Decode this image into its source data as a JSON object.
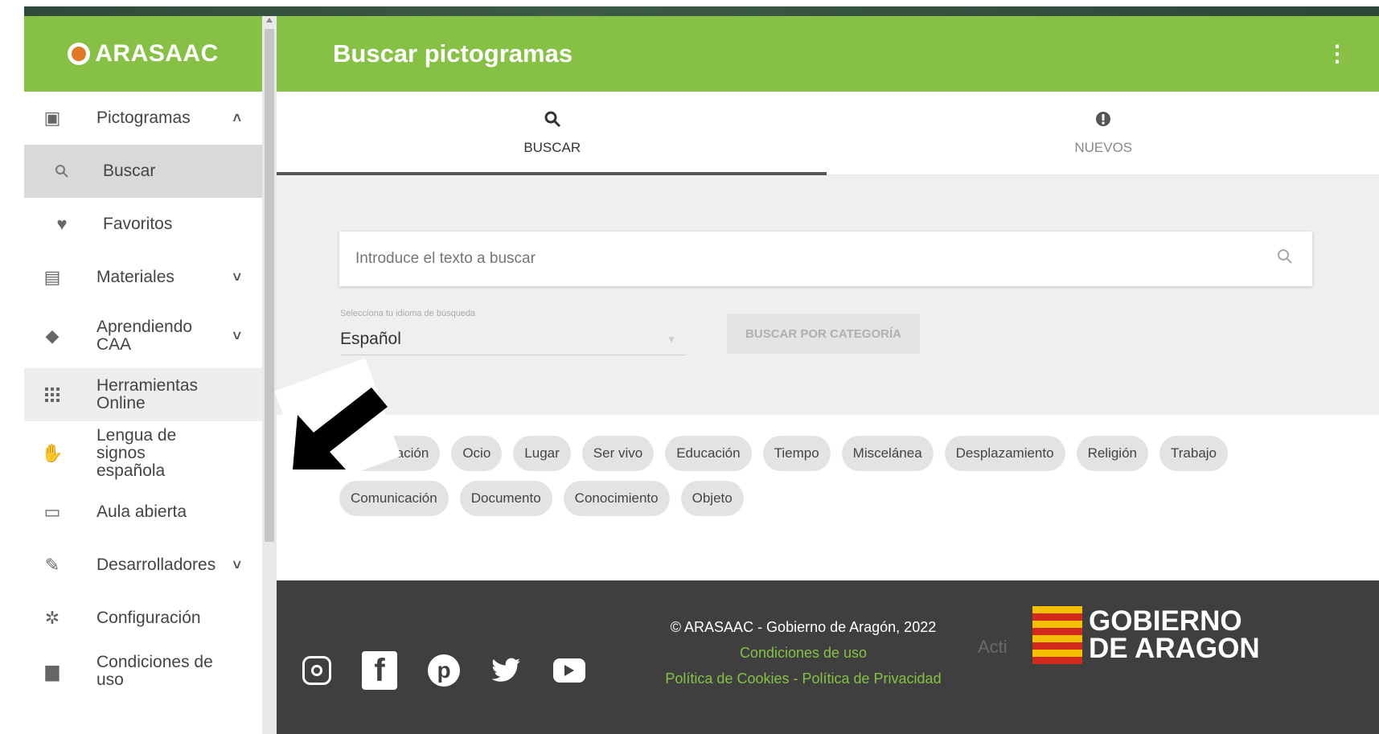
{
  "sidebar": {
    "logo_text": "ARASAAC",
    "items": [
      {
        "label": "Pictogramas",
        "icon": "pictogram-icon",
        "chevron": "˄"
      },
      {
        "label": "Buscar",
        "icon": "search-icon"
      },
      {
        "label": "Favoritos",
        "icon": "heart-icon"
      },
      {
        "label": "Materiales",
        "icon": "materials-icon",
        "chevron": "˅"
      },
      {
        "label": "Aprendiendo CAA",
        "icon": "graduation-cap-icon",
        "chevron": "˅"
      },
      {
        "label": "Herramientas Online",
        "icon": "apps-grid-icon"
      },
      {
        "label": "Lengua de signos española",
        "icon": "sign-language-icon"
      },
      {
        "label": "Aula abierta",
        "icon": "classroom-icon"
      },
      {
        "label": "Desarrolladores",
        "icon": "wrench-icon",
        "chevron": "˅"
      },
      {
        "label": "Configuración",
        "icon": "gear-icon"
      },
      {
        "label": "Condiciones de uso",
        "icon": "briefcase-icon"
      }
    ]
  },
  "header": {
    "title": "Buscar pictogramas",
    "more_icon": "⋮"
  },
  "tabs": [
    {
      "label": "BUSCAR",
      "icon": "search-icon"
    },
    {
      "label": "NUEVOS",
      "icon": "new-badge-icon"
    }
  ],
  "search": {
    "placeholder": "Introduce el texto a buscar",
    "language_label": "Selecciona tu idioma de búsqueda",
    "language_value": "Español",
    "category_button": "BUSCAR POR CATEGORÍA"
  },
  "chips": [
    "Alimentación",
    "Ocio",
    "Lugar",
    "Ser vivo",
    "Educación",
    "Tiempo",
    "Miscelánea",
    "Desplazamiento",
    "Religión",
    "Trabajo",
    "Comunicación",
    "Documento",
    "Conocimiento",
    "Objeto"
  ],
  "footer": {
    "copyright": "© ARASAAC - Gobierno de Aragón, 2022",
    "terms": "Condiciones de uso",
    "policies": "Política de Cookies - Política de Privacidad",
    "gov_line1": "GOBIERNO",
    "gov_line2": "DE ARAGON",
    "watermark": "Acti",
    "social": [
      "instagram-icon",
      "facebook-icon",
      "pinterest-icon",
      "twitter-icon",
      "youtube-icon"
    ]
  },
  "colors": {
    "brand_green": "#86c044",
    "footer_bg": "#3f3f3f",
    "active_item": "#d9d9d9"
  }
}
